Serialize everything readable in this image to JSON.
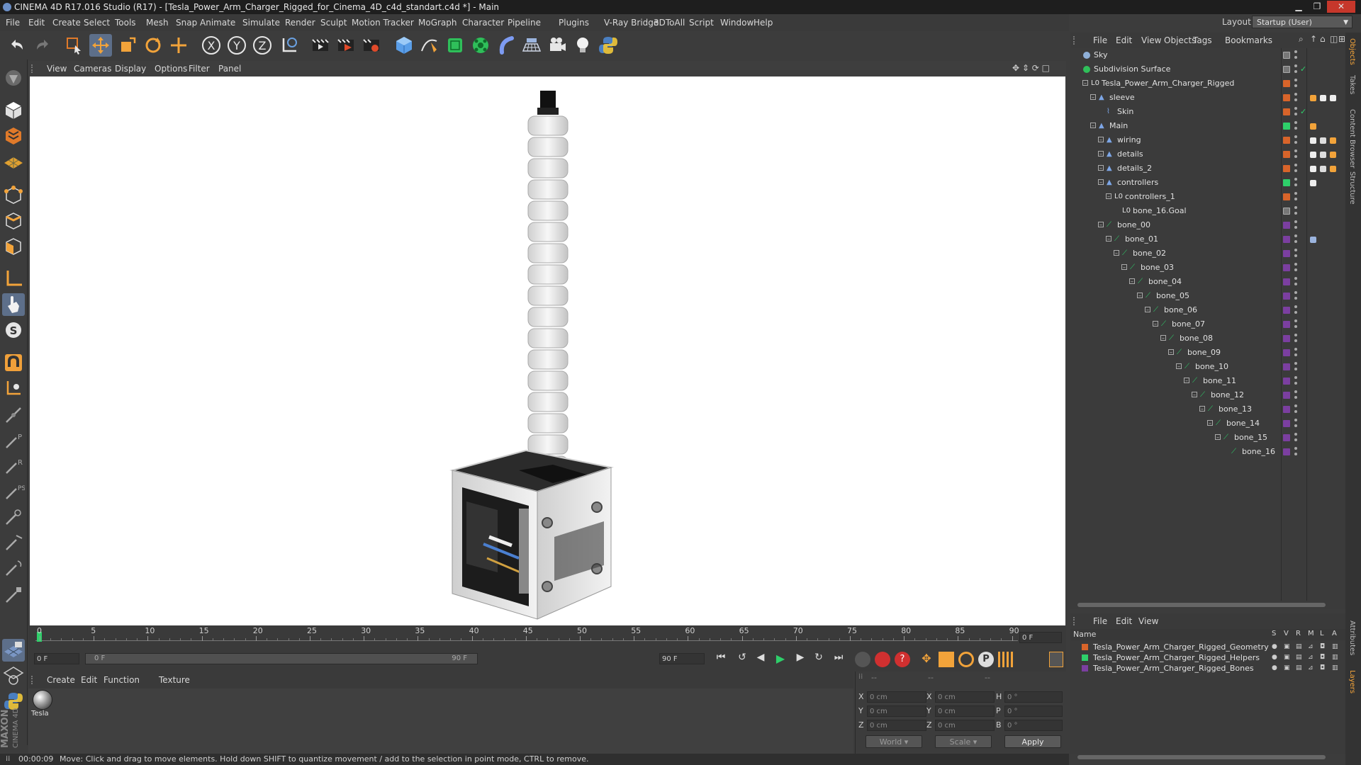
{
  "window": {
    "title": "CINEMA 4D R17.016 Studio (R17) - [Tesla_Power_Arm_Charger_Rigged_for_Cinema_4D_c4d_standart.c4d *] - Main",
    "layout_label": "Layout:",
    "layout_value": "Startup (User)"
  },
  "menubar": [
    "File",
    "Edit",
    "Create",
    "Select",
    "Tools",
    "Mesh",
    "Snap",
    "Animate",
    "Simulate",
    "Render",
    "Sculpt",
    "Motion Tracker",
    "MoGraph",
    "Character",
    "Pipeline",
    "Plugins",
    "V-Ray Bridge",
    "3DToAll",
    "Script",
    "Window",
    "Help"
  ],
  "viewport": {
    "menu": [
      "View",
      "Cameras",
      "Display",
      "Options",
      "Filter",
      "Panel"
    ]
  },
  "timeline": {
    "ticks": [
      "0",
      "5",
      "10",
      "15",
      "20",
      "25",
      "30",
      "35",
      "40",
      "45",
      "50",
      "55",
      "60",
      "65",
      "70",
      "75",
      "80",
      "85",
      "90"
    ],
    "current_frame_field": "0 F",
    "start_field": "0 F",
    "range_start": "0 F",
    "range_end": "90 F",
    "end_field": "90 F",
    "frame_readout": "0 F"
  },
  "material_manager": {
    "menu": [
      "Create",
      "Edit",
      "Function",
      "Texture"
    ],
    "materials": [
      {
        "name": "Tesla"
      }
    ]
  },
  "coordinates": {
    "header_dots": [
      "--",
      "--",
      "--"
    ],
    "rows": [
      {
        "a": "X",
        "av": "0 cm",
        "b": "X",
        "bv": "0 cm",
        "c": "H",
        "cv": "0 °"
      },
      {
        "a": "Y",
        "av": "0 cm",
        "b": "Y",
        "bv": "0 cm",
        "c": "P",
        "cv": "0 °"
      },
      {
        "a": "Z",
        "av": "0 cm",
        "b": "Z",
        "bv": "0 cm",
        "c": "B",
        "cv": "0 °"
      }
    ],
    "world": "World",
    "scale": "Scale",
    "apply": "Apply"
  },
  "status": {
    "time": "00:00:09",
    "message": "Move: Click and drag to move elements. Hold down SHIFT to quantize movement / add to the selection in point mode, CTRL to remove."
  },
  "object_manager": {
    "menu": [
      "File",
      "Edit",
      "View",
      "Objects",
      "Tags",
      "Bookmarks"
    ],
    "objects": [
      {
        "name": "Sky",
        "depth": 0,
        "icon": "sky",
        "color": "#8a8a8a",
        "check": false
      },
      {
        "name": "Subdivision Surface",
        "depth": 0,
        "icon": "subd",
        "color": "#8a8a8a",
        "check": true
      },
      {
        "name": "Tesla_Power_Arm_Charger_Rigged",
        "depth": 1,
        "icon": "null",
        "color": "#d8642a",
        "check": false
      },
      {
        "name": "sleeve",
        "depth": 2,
        "icon": "joint",
        "color": "#d8642a",
        "check": false
      },
      {
        "name": "Skin",
        "depth": 3,
        "icon": "skin",
        "color": "#d8642a",
        "check": true
      },
      {
        "name": "Main",
        "depth": 2,
        "icon": "joint",
        "color": "#2ecf6a",
        "check": false
      },
      {
        "name": "wiring",
        "depth": 3,
        "icon": "joint",
        "color": "#d8642a",
        "check": false
      },
      {
        "name": "details",
        "depth": 3,
        "icon": "joint",
        "color": "#d8642a",
        "check": false
      },
      {
        "name": "details_2",
        "depth": 3,
        "icon": "joint",
        "color": "#d8642a",
        "check": false
      },
      {
        "name": "controllers",
        "depth": 3,
        "icon": "joint",
        "color": "#2ecf6a",
        "check": false
      },
      {
        "name": "controllers_1",
        "depth": 4,
        "icon": "null",
        "color": "#d8642a",
        "check": false
      },
      {
        "name": "bone_16.Goal",
        "depth": 5,
        "icon": "null",
        "color": "#8a8a8a",
        "check": false
      },
      {
        "name": "bone_00",
        "depth": 3,
        "icon": "bone",
        "color": "#7b3fa0",
        "check": false
      },
      {
        "name": "bone_01",
        "depth": 4,
        "icon": "bone",
        "color": "#7b3fa0",
        "check": false
      },
      {
        "name": "bone_02",
        "depth": 5,
        "icon": "bone",
        "color": "#7b3fa0",
        "check": false
      },
      {
        "name": "bone_03",
        "depth": 6,
        "icon": "bone",
        "color": "#7b3fa0",
        "check": false
      },
      {
        "name": "bone_04",
        "depth": 7,
        "icon": "bone",
        "color": "#7b3fa0",
        "check": false
      },
      {
        "name": "bone_05",
        "depth": 8,
        "icon": "bone",
        "color": "#7b3fa0",
        "check": false
      },
      {
        "name": "bone_06",
        "depth": 9,
        "icon": "bone",
        "color": "#7b3fa0",
        "check": false
      },
      {
        "name": "bone_07",
        "depth": 10,
        "icon": "bone",
        "color": "#7b3fa0",
        "check": false
      },
      {
        "name": "bone_08",
        "depth": 11,
        "icon": "bone",
        "color": "#7b3fa0",
        "check": false
      },
      {
        "name": "bone_09",
        "depth": 12,
        "icon": "bone",
        "color": "#7b3fa0",
        "check": false
      },
      {
        "name": "bone_10",
        "depth": 13,
        "icon": "bone",
        "color": "#7b3fa0",
        "check": false
      },
      {
        "name": "bone_11",
        "depth": 14,
        "icon": "bone",
        "color": "#7b3fa0",
        "check": false
      },
      {
        "name": "bone_12",
        "depth": 15,
        "icon": "bone",
        "color": "#7b3fa0",
        "check": false
      },
      {
        "name": "bone_13",
        "depth": 16,
        "icon": "bone",
        "color": "#7b3fa0",
        "check": false
      },
      {
        "name": "bone_14",
        "depth": 17,
        "icon": "bone",
        "color": "#7b3fa0",
        "check": false
      },
      {
        "name": "bone_15",
        "depth": 18,
        "icon": "bone",
        "color": "#7b3fa0",
        "check": false
      },
      {
        "name": "bone_16",
        "depth": 19,
        "icon": "bone",
        "color": "#7b3fa0",
        "check": false
      }
    ]
  },
  "layer_manager": {
    "menu": [
      "File",
      "Edit",
      "View"
    ],
    "col_name": "Name",
    "cols": [
      "S",
      "V",
      "R",
      "M",
      "L",
      "A"
    ],
    "layers": [
      {
        "name": "Tesla_Power_Arm_Charger_Rigged_Geometry",
        "color": "#d8642a"
      },
      {
        "name": "Tesla_Power_Arm_Charger_Rigged_Helpers",
        "color": "#2ecf6a"
      },
      {
        "name": "Tesla_Power_Arm_Charger_Rigged_Bones",
        "color": "#7b3fa0"
      }
    ]
  },
  "side_tabs": [
    "Objects",
    "Takes",
    "Content Browser",
    "Structure",
    "Attributes",
    "Layers"
  ]
}
